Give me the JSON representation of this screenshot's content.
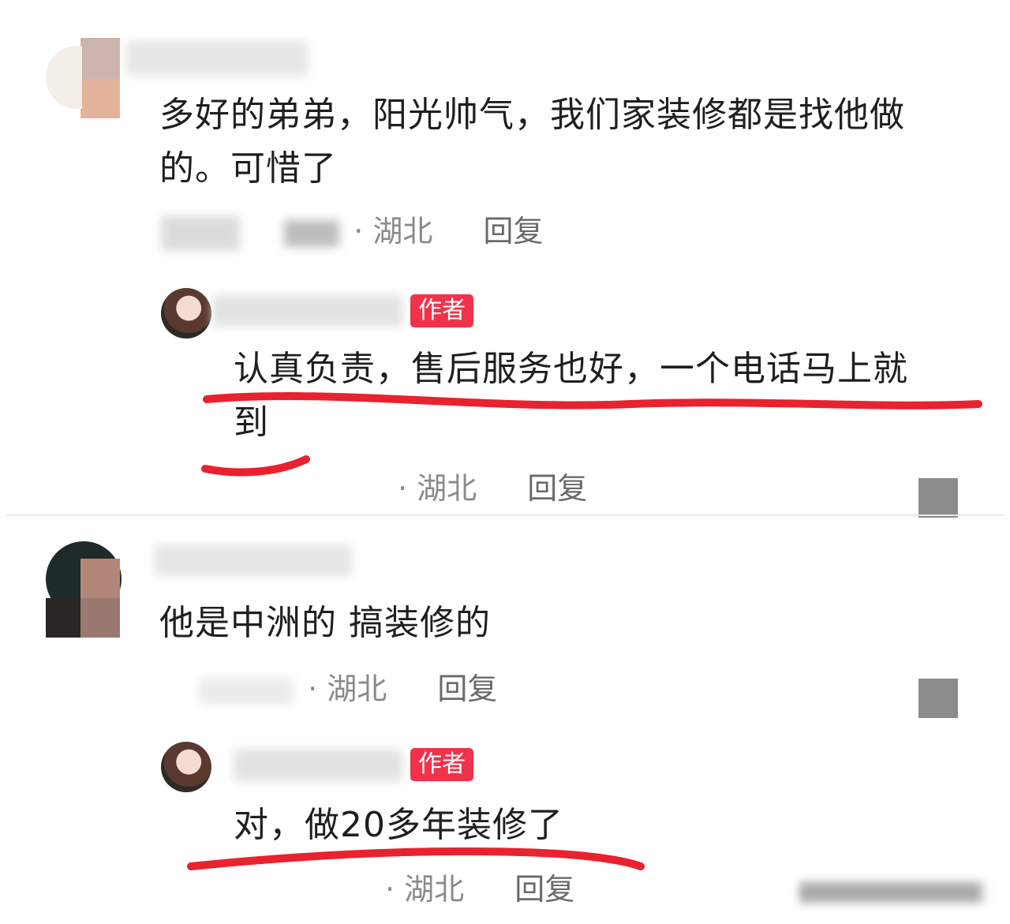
{
  "comments": [
    {
      "text_line1": "多好的弟弟，阳光帅气，我们家装修都是找他做",
      "text_line2": "的。可惜了",
      "location": "湖北",
      "reply_label": "回复",
      "reply": {
        "badge": "作者",
        "text_line1": "认真负责，售后服务也好，一个电话马上就",
        "text_line2": "到",
        "location": "湖北",
        "reply_label": "回复"
      }
    },
    {
      "text_line1": "他是中洲的 搞装修的",
      "location": "湖北",
      "reply_label": "回复",
      "reply": {
        "badge": "作者",
        "text_line1": "对，做20多年装修了",
        "location": "湖北",
        "reply_label": "回复"
      }
    }
  ],
  "colors": {
    "badge": "#f0324b",
    "underline": "#e8222f",
    "meta_text": "#8a8a8a"
  }
}
